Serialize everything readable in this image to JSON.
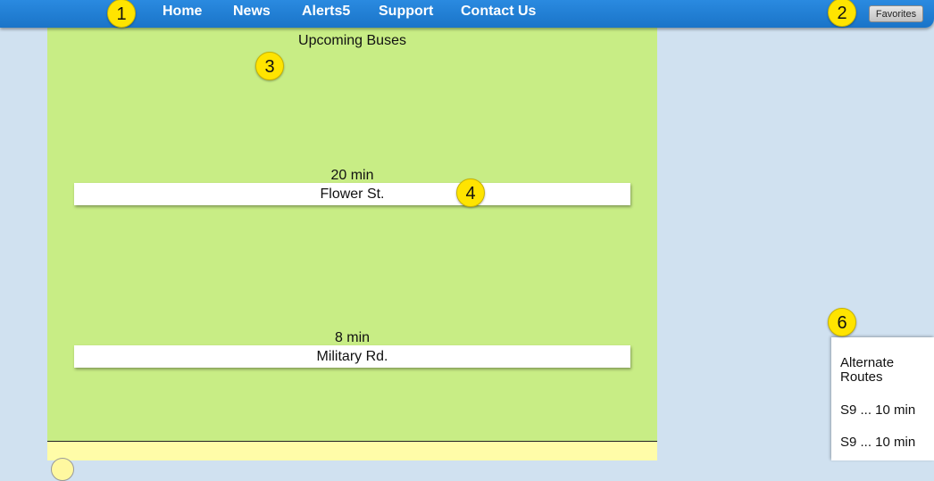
{
  "nav": {
    "links": [
      "Home",
      "News",
      "Alerts5",
      "Support",
      "Contact Us"
    ],
    "favorites_label": "Favorites"
  },
  "badges": [
    "1",
    "2",
    "3",
    "4",
    "6"
  ],
  "upcoming": {
    "title": "Upcoming Buses",
    "buses": [
      {
        "time": "20 min",
        "stop": "Flower St."
      },
      {
        "time": "8 min",
        "stop": "Military Rd."
      }
    ]
  },
  "alternate": {
    "title": "Alternate Routes",
    "routes": [
      "S9  ...  10 min",
      "S9  ...  10 min"
    ]
  }
}
